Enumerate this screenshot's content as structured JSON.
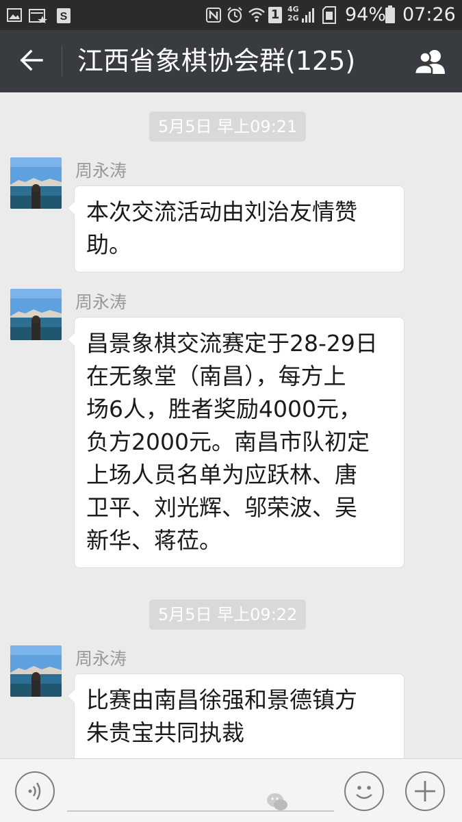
{
  "status_bar": {
    "battery": "94%",
    "time": "07:26",
    "sim": "1",
    "network": "4G",
    "network2": "2G"
  },
  "header": {
    "title": "江西省象棋协会群(125)",
    "back_icon": "back-arrow-icon",
    "members_icon": "group-members-icon"
  },
  "messages": [
    {
      "time": "5月5日 早上09:21"
    },
    {
      "sender": "周永涛",
      "lines": [
        "本次交流活动由刘治友情赞",
        "助。"
      ]
    },
    {
      "sender": "周永涛",
      "lines": [
        "昌景象棋交流赛定于28-29日",
        "在无象堂（南昌），每方上",
        "场6人，胜者奖励4000元，",
        "负方2000元。南昌市队初定",
        "上场人员名单为应跃林、唐",
        "卫平、刘光辉、邬荣波、吴",
        "新华、蒋莅。"
      ]
    },
    {
      "time": "5月5日 早上09:22"
    },
    {
      "sender": "周永涛",
      "lines": [
        "比赛由南昌徐强和景德镇方",
        "朱贵宝共同执裁"
      ]
    }
  ],
  "input_bar": {
    "voice_icon": "voice-icon",
    "emoji_icon": "emoji-icon",
    "plus_icon": "plus-icon"
  },
  "colors": {
    "title_bar": "#383b3f",
    "status_bar": "#2b2b2b",
    "chat_background": "#ebebeb",
    "bubble": "#ffffff"
  }
}
